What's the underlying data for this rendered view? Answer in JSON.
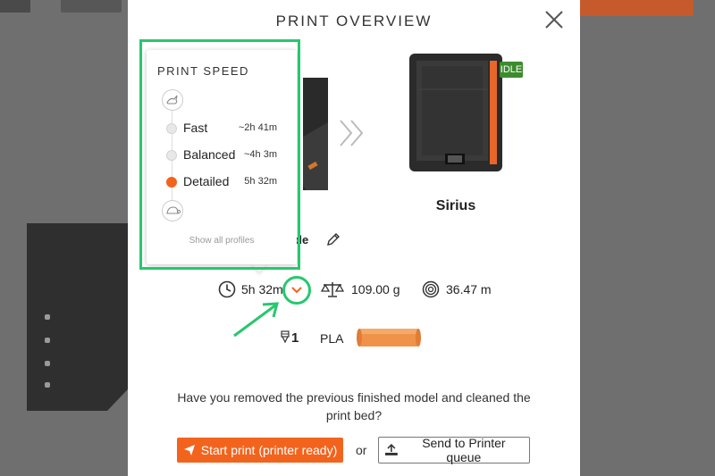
{
  "modal": {
    "title": "PRINT OVERVIEW",
    "close_icon": "close-icon"
  },
  "printer": {
    "name": "Sirius",
    "status": "IDLE",
    "status_color": "#3d8b2f"
  },
  "mode": {
    "text_fragment": "de",
    "edit_icon": "pencil-icon"
  },
  "stats": {
    "time": "5h 32m",
    "weight": "109.00 g",
    "length": "36.47 m"
  },
  "material": {
    "nozzle_index": "1",
    "type": "PLA",
    "color": "#f0924a"
  },
  "print_speed": {
    "title": "PRINT SPEED",
    "options": [
      {
        "label": "Fast",
        "time": "~2h 41m",
        "selected": false
      },
      {
        "label": "Balanced",
        "time": "~4h 3m",
        "selected": false
      },
      {
        "label": "Detailed",
        "time": "5h 32m",
        "selected": true
      }
    ],
    "show_all": "Show all profiles"
  },
  "confirm": {
    "question": "Have you removed the previous finished model and cleaned the print bed?",
    "start_label": "Start print (printer ready)",
    "or_label": "or",
    "queue_label": "Send to Printer queue"
  },
  "colors": {
    "accent": "#f2641e",
    "annotation": "#28c76f"
  }
}
